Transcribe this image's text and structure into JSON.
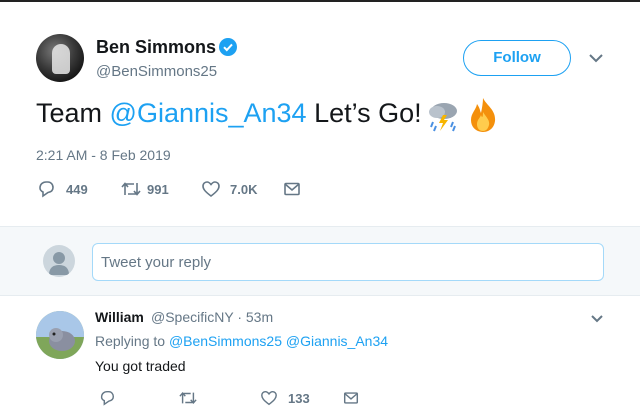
{
  "tweet": {
    "author_name": "Ben Simmons",
    "author_handle": "@BenSimmons25",
    "follow_label": "Follow",
    "text_prefix": "Team ",
    "mention": "@Giannis_An34",
    "text_suffix": " Let’s Go! ",
    "timestamp": "2:21 AM - 8 Feb 2019",
    "replies": "449",
    "retweets": "991",
    "likes": "7.0K"
  },
  "reply_box": {
    "placeholder": "Tweet your reply"
  },
  "reply": {
    "name": "William",
    "meta": "@SpecificNY · 53m",
    "replying_label": "Replying to ",
    "replying_to_1": "@BenSimmons25",
    "replying_to_2": "@Giannis_An34",
    "text": "You got traded",
    "likes": "133"
  },
  "colors": {
    "accent": "#1da1f2",
    "secondary_text": "#657786",
    "primary_text": "#14171a"
  },
  "icons": [
    "verified-badge-icon",
    "chevron-down-icon",
    "reply-icon",
    "retweet-icon",
    "like-icon",
    "dm-icon",
    "storm-emoji",
    "fire-emoji"
  ]
}
